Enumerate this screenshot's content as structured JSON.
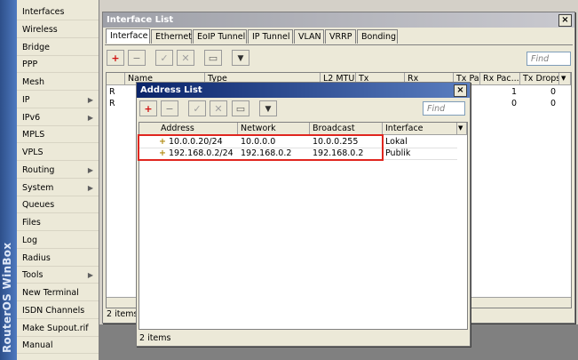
{
  "brand": "RouterOS WinBox",
  "sidebar": {
    "items": [
      {
        "label": "Interfaces",
        "arrow": false
      },
      {
        "label": "Wireless",
        "arrow": false
      },
      {
        "label": "Bridge",
        "arrow": false
      },
      {
        "label": "PPP",
        "arrow": false
      },
      {
        "label": "Mesh",
        "arrow": false
      },
      {
        "label": "IP",
        "arrow": true
      },
      {
        "label": "IPv6",
        "arrow": true
      },
      {
        "label": "MPLS",
        "arrow": false
      },
      {
        "label": "VPLS",
        "arrow": false
      },
      {
        "label": "Routing",
        "arrow": true
      },
      {
        "label": "System",
        "arrow": true
      },
      {
        "label": "Queues",
        "arrow": false
      },
      {
        "label": "Files",
        "arrow": false
      },
      {
        "label": "Log",
        "arrow": false
      },
      {
        "label": "Radius",
        "arrow": false
      },
      {
        "label": "Tools",
        "arrow": true
      },
      {
        "label": "New Terminal",
        "arrow": false
      },
      {
        "label": "ISDN Channels",
        "arrow": false
      },
      {
        "label": "Make Supout.rif",
        "arrow": false
      },
      {
        "label": "Manual",
        "arrow": false
      }
    ]
  },
  "interface_list": {
    "title": "Interface List",
    "close": "×",
    "tabs": [
      "Interface",
      "Ethernet",
      "EoIP Tunnel",
      "IP Tunnel",
      "VLAN",
      "VRRP",
      "Bonding"
    ],
    "find_placeholder": "Find",
    "columns": [
      "Name",
      "Type",
      "L2 MTU",
      "Tx",
      "Rx",
      "Tx Pac...",
      "Rx Pac...",
      "Tx Drops"
    ],
    "rows": [
      {
        "flag": "R",
        "rx_pac": "1",
        "tx_drops": "0"
      },
      {
        "flag": "R",
        "rx_pac": "0",
        "tx_drops": "0"
      }
    ],
    "status": "2 items"
  },
  "address_list": {
    "title": "Address List",
    "close": "×",
    "find_placeholder": "Find",
    "columns": [
      "Address",
      "Network",
      "Broadcast",
      "Interface"
    ],
    "rows": [
      {
        "address": "10.0.0.20/24",
        "network": "10.0.0.0",
        "broadcast": "10.0.0.255",
        "interface": "Lokal"
      },
      {
        "address": "192.168.0.2/24",
        "network": "192.168.0.2",
        "broadcast": "192.168.0.2",
        "interface": "Publik"
      }
    ],
    "status": "2 items"
  },
  "icons": {
    "add": "+",
    "remove": "−",
    "enable": "✓",
    "disable": "✕",
    "comment": "▭",
    "filter": "▼",
    "dropdown": "▼",
    "arrow": "▶"
  },
  "colors": {
    "active_title": "#0a246a",
    "highlight": "#e0261f",
    "add_icon": "#d01010"
  }
}
